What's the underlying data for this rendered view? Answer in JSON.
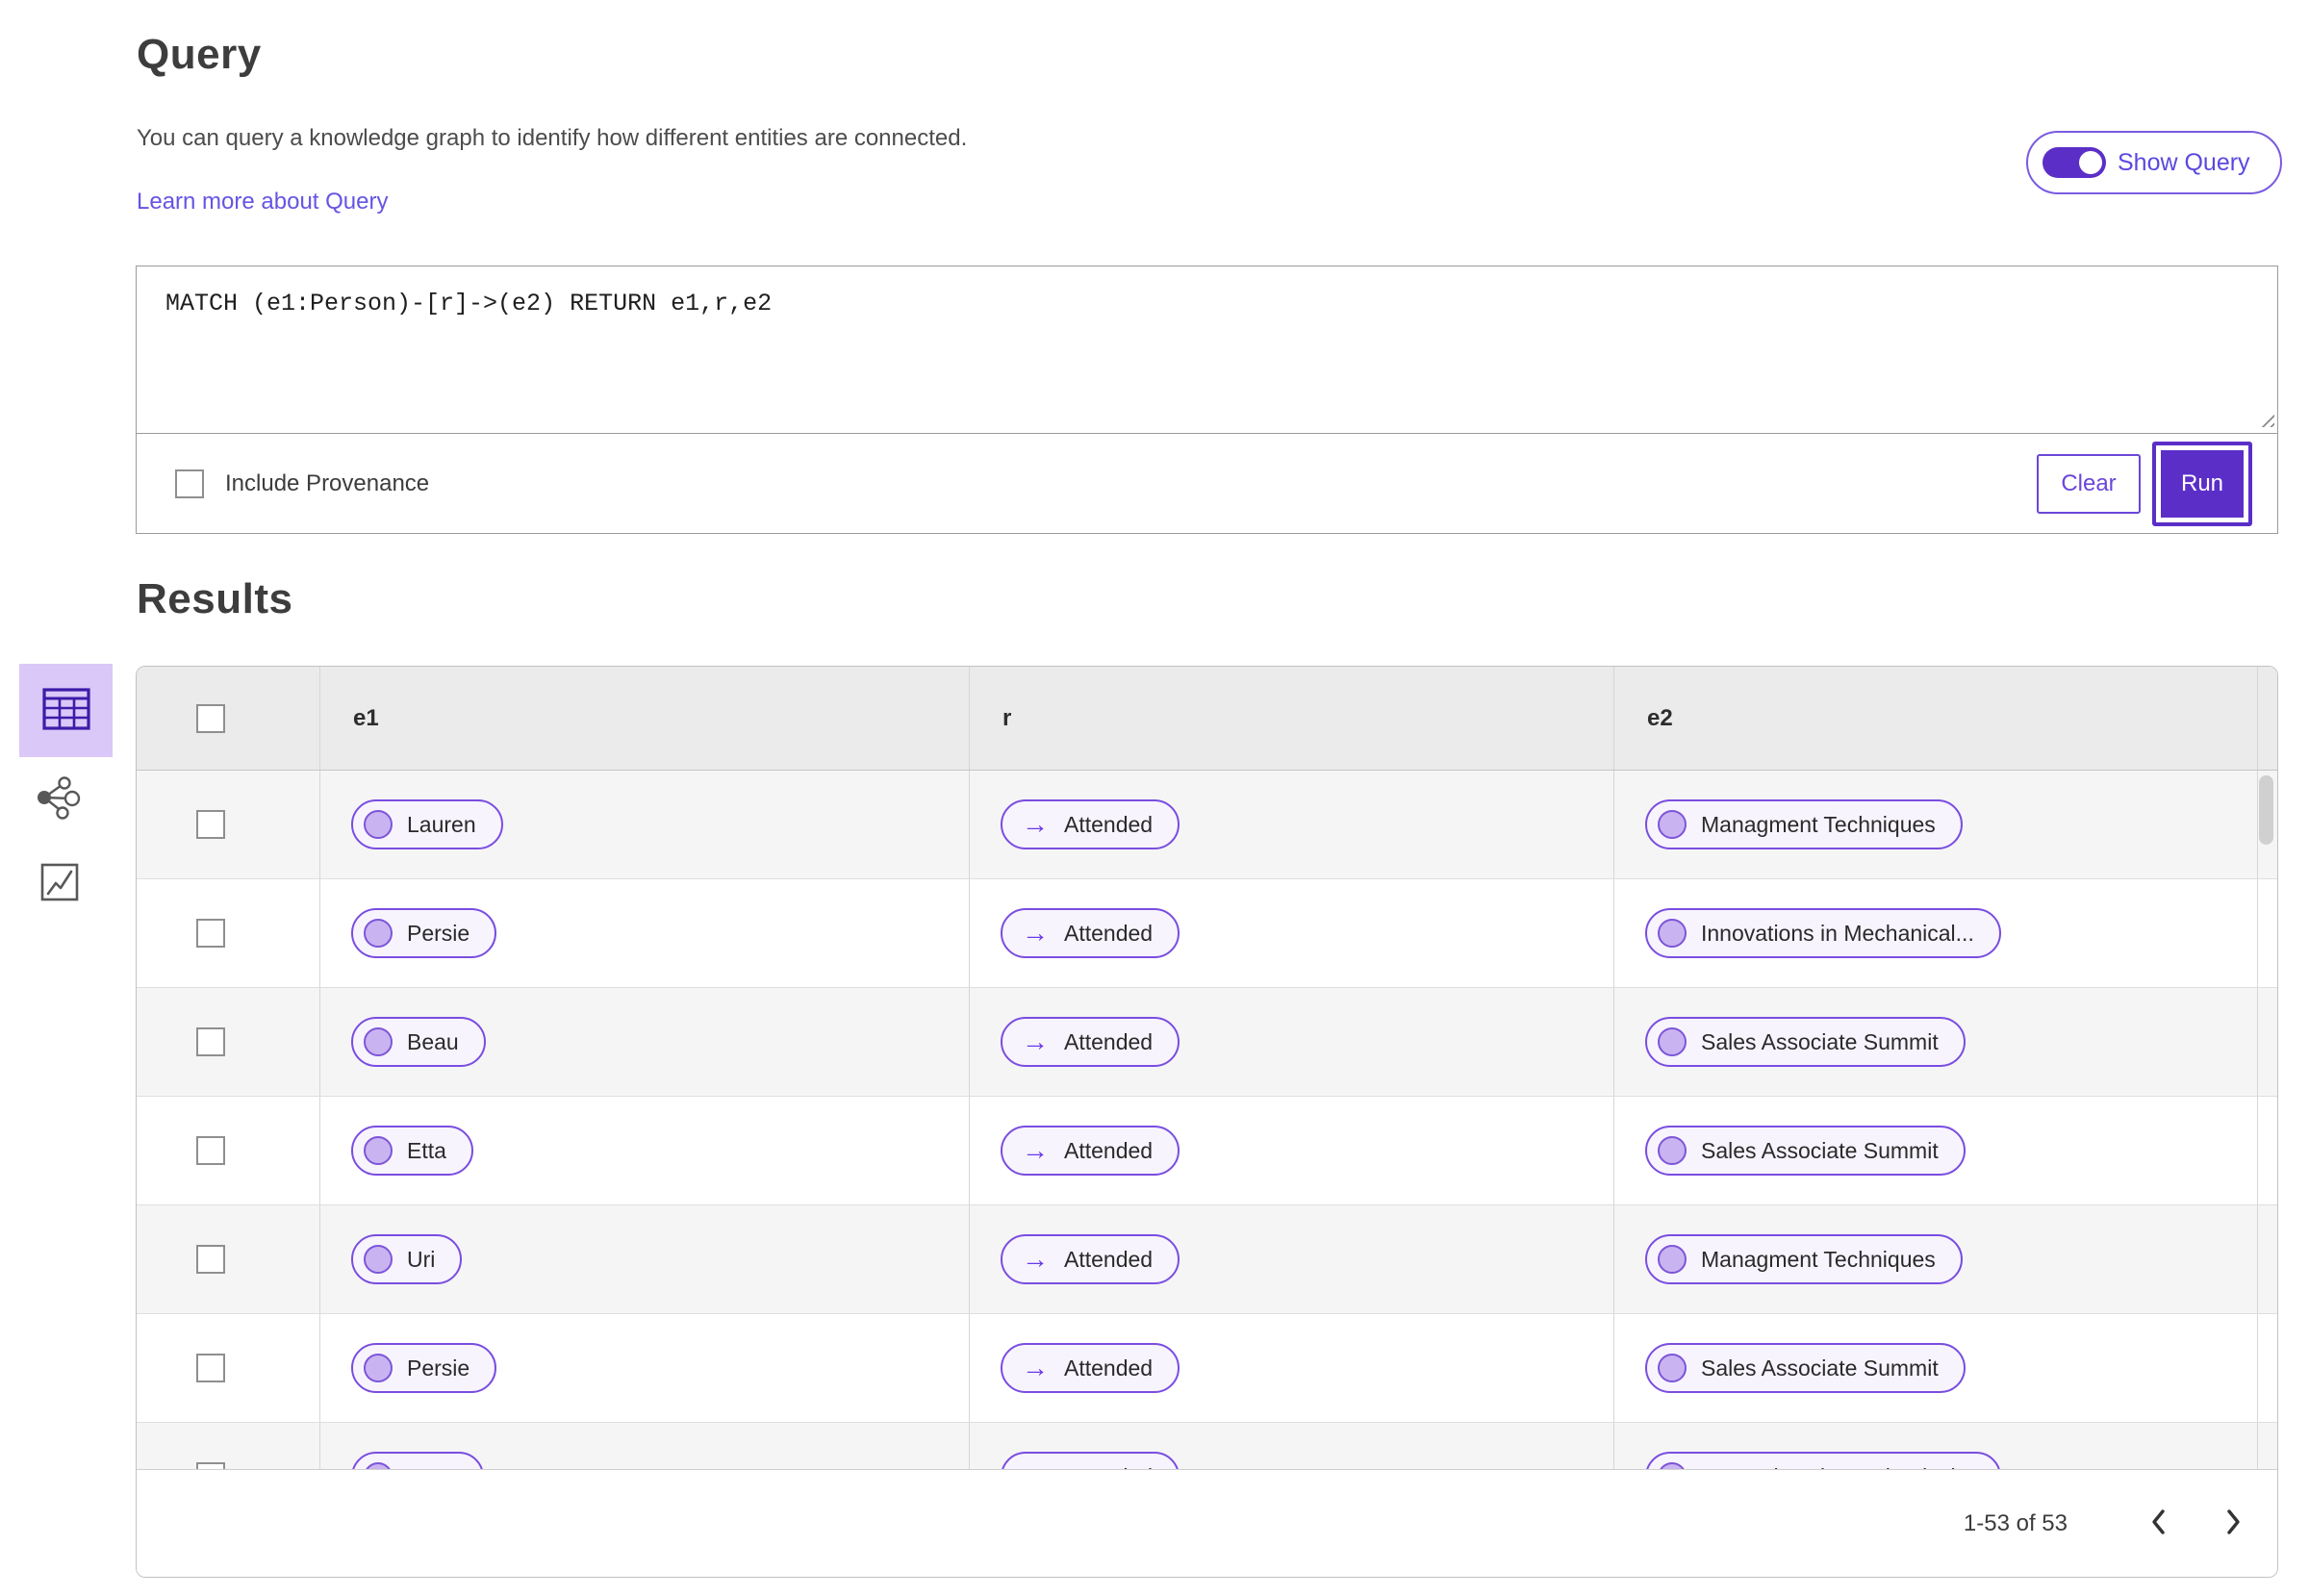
{
  "query": {
    "title": "Query",
    "description": "You can query a knowledge graph to identify how different entities are connected.",
    "learn_more_link": "Learn more about Query",
    "show_query_label": "Show Query",
    "show_query_state": "on",
    "editor_value": "MATCH (e1:Person)-[r]->(e2) RETURN e1,r,e2",
    "include_provenance_label": "Include Provenance",
    "include_provenance_checked": false,
    "clear_button": "Clear",
    "run_button": "Run"
  },
  "results": {
    "title": "Results",
    "view_switcher": [
      {
        "name": "table-view",
        "icon": "table-icon",
        "selected": true
      },
      {
        "name": "network-view",
        "icon": "network-graph-icon",
        "selected": false
      },
      {
        "name": "chart-view",
        "icon": "chart-icon",
        "selected": false
      }
    ],
    "table": {
      "columns": [
        "e1",
        "r",
        "e2"
      ],
      "relation_arrow": "→",
      "rows": [
        {
          "e1": "Lauren",
          "r": "Attended",
          "e2": "Managment Techniques"
        },
        {
          "e1": "Persie",
          "r": "Attended",
          "e2": "Innovations in Mechanical..."
        },
        {
          "e1": "Beau",
          "r": "Attended",
          "e2": "Sales Associate Summit"
        },
        {
          "e1": "Etta",
          "r": "Attended",
          "e2": "Sales Associate Summit"
        },
        {
          "e1": "Uri",
          "r": "Attended",
          "e2": "Managment Techniques"
        },
        {
          "e1": "Persie",
          "r": "Attended",
          "e2": "Sales Associate Summit"
        },
        {
          "e1": "Larry",
          "r": "Attended",
          "e2": "Innovations in Mechanical..."
        }
      ]
    },
    "pagination": {
      "range_label": "1-53 of 53"
    }
  },
  "colors": {
    "accent_purple": "#5b2ec8",
    "link_purple": "#6554e3",
    "pill_border": "#7a4de0",
    "pill_background": "#f7f4fe",
    "pill_dot_fill": "#c9b4f1",
    "selected_view_background": "#d9c8f8",
    "header_row_background": "#ebebeb",
    "alt_row_background": "#f5f5f5"
  }
}
